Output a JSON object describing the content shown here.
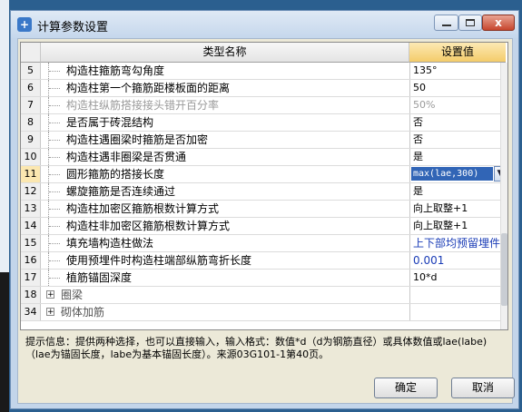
{
  "window": {
    "title": "计算参数设置",
    "close_glyph": "x"
  },
  "grid": {
    "header_name": "类型名称",
    "header_value": "设置值",
    "rows": [
      {
        "num": "5",
        "name": "构造柱箍筋弯勾角度",
        "value": "135°"
      },
      {
        "num": "6",
        "name": "构造柱第一个箍筋距楼板面的距离",
        "value": "50"
      },
      {
        "num": "7",
        "name": "构造柱纵筋搭接接头错开百分率",
        "value": "50%"
      },
      {
        "num": "8",
        "name": "是否属于砖混结构",
        "value": "否"
      },
      {
        "num": "9",
        "name": "构造柱遇圈梁时箍筋是否加密",
        "value": "否"
      },
      {
        "num": "10",
        "name": "构造柱遇非圈梁是否贯通",
        "value": "是"
      },
      {
        "num": "11",
        "name": "圆形箍筋的搭接长度",
        "value": "max(lae,300)"
      },
      {
        "num": "12",
        "name": "螺旋箍筋是否连续通过",
        "value": "是"
      },
      {
        "num": "13",
        "name": "构造柱加密区箍筋根数计算方式",
        "value": "向上取整+1"
      },
      {
        "num": "14",
        "name": "构造柱非加密区箍筋根数计算方式",
        "value": "向上取整+1"
      },
      {
        "num": "15",
        "name": "填充墙构造柱做法",
        "value": "上下部均预留埋件"
      },
      {
        "num": "16",
        "name": "使用预埋件时构造柱端部纵筋弯折长度",
        "value": "0.001"
      },
      {
        "num": "17",
        "name": "植筋锚固深度",
        "value": "10*d"
      }
    ],
    "groups": [
      {
        "num": "18",
        "name": "圈梁",
        "expander": "+"
      },
      {
        "num": "34",
        "name": "砌体加筋",
        "expander": "+"
      }
    ],
    "dropdown_glyph": "▼"
  },
  "hint": {
    "text": "提示信息：提供两种选择，也可以直接输入，输入格式：数值*d（d为钢筋直径）或具体数值或lae(labe)（lae为锚固长度，labe为基本锚固长度）。来源03G101-1第40页。"
  },
  "buttons": {
    "ok": "确定",
    "cancel": "取消"
  }
}
